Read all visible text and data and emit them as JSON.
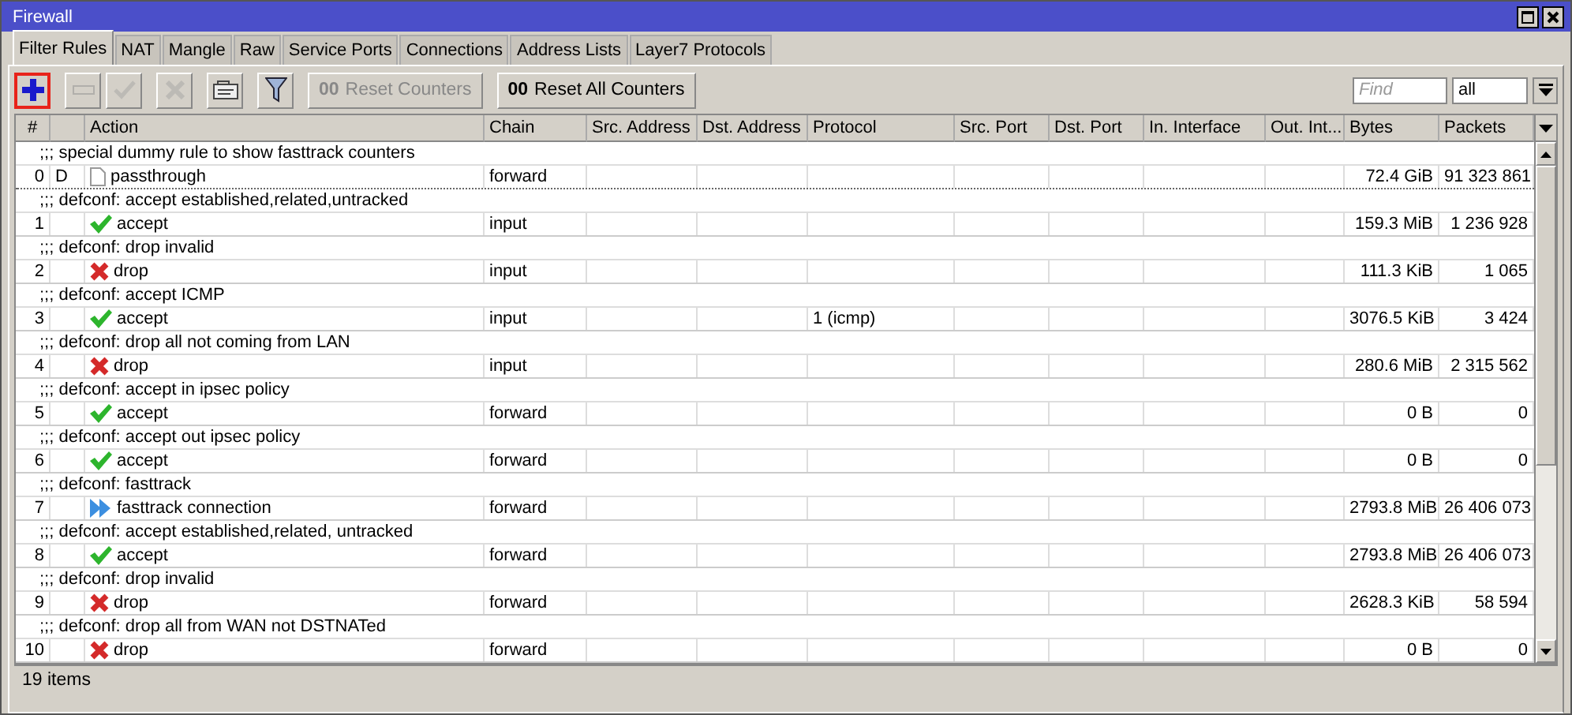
{
  "window": {
    "title": "Firewall"
  },
  "tabs": [
    {
      "label": "Filter Rules",
      "selected": true
    },
    {
      "label": "NAT",
      "selected": false
    },
    {
      "label": "Mangle",
      "selected": false
    },
    {
      "label": "Raw",
      "selected": false
    },
    {
      "label": "Service Ports",
      "selected": false
    },
    {
      "label": "Connections",
      "selected": false
    },
    {
      "label": "Address Lists",
      "selected": false
    },
    {
      "label": "Layer7 Protocols",
      "selected": false
    }
  ],
  "toolbar": {
    "buttons": [
      {
        "kind": "add",
        "disabled": false,
        "highlighted": true
      },
      {
        "kind": "remove",
        "disabled": true,
        "highlighted": false
      },
      {
        "kind": "enable",
        "disabled": true,
        "highlighted": false
      },
      {
        "kind": "disable",
        "disabled": true,
        "highlighted": false
      },
      {
        "kind": "comment",
        "disabled": false,
        "highlighted": false
      },
      {
        "kind": "filter",
        "disabled": false,
        "highlighted": false
      },
      {
        "kind": "counter",
        "label": "Reset Counters",
        "prefix": "00",
        "disabled": true,
        "highlighted": false
      },
      {
        "kind": "counter",
        "label": "Reset All Counters",
        "prefix": "00",
        "disabled": false,
        "highlighted": false
      }
    ],
    "find": {
      "placeholder": "Find"
    },
    "filter_select": {
      "value": "all"
    }
  },
  "table": {
    "columns": [
      "#",
      "Action",
      "Chain",
      "Src. Address",
      "Dst. Address",
      "Protocol",
      "Src. Port",
      "Dst. Port",
      "In. Interface",
      "Out. Int...",
      "Bytes",
      "Packets"
    ],
    "rows": [
      {
        "comment": ";;; special dummy rule to show fasttrack counters",
        "number": "0",
        "flag": "D",
        "action": "passthrough",
        "kind": "passthrough",
        "chain": "forward",
        "bytes": "72.4 GiB",
        "packets": "91 323 861"
      },
      {
        "comment": ";;; defconf: accept established,related,untracked",
        "number": "1",
        "action": "accept",
        "kind": "accept",
        "chain": "input",
        "bytes": "159.3 MiB",
        "packets": "1 236 928"
      },
      {
        "comment": ";;; defconf: drop invalid",
        "number": "2",
        "action": "drop",
        "kind": "drop",
        "chain": "input",
        "bytes": "111.3 KiB",
        "packets": "1 065"
      },
      {
        "comment": ";;; defconf: accept ICMP",
        "number": "3",
        "action": "accept",
        "kind": "accept",
        "chain": "input",
        "protocol": "1 (icmp)",
        "bytes": "3076.5 KiB",
        "packets": "3 424"
      },
      {
        "comment": ";;; defconf: drop all not coming from LAN",
        "number": "4",
        "action": "drop",
        "kind": "drop",
        "chain": "input",
        "bytes": "280.6 MiB",
        "packets": "2 315 562"
      },
      {
        "comment": ";;; defconf: accept in ipsec policy",
        "number": "5",
        "action": "accept",
        "kind": "accept",
        "chain": "forward",
        "bytes": "0 B",
        "packets": "0"
      },
      {
        "comment": ";;; defconf: accept out ipsec policy",
        "number": "6",
        "action": "accept",
        "kind": "accept",
        "chain": "forward",
        "bytes": "0 B",
        "packets": "0"
      },
      {
        "comment": ";;; defconf: fasttrack",
        "number": "7",
        "action": "fasttrack connection",
        "kind": "fasttrack",
        "chain": "forward",
        "bytes": "2793.8 MiB",
        "packets": "26 406 073"
      },
      {
        "comment": ";;; defconf: accept established,related, untracked",
        "number": "8",
        "action": "accept",
        "kind": "accept",
        "chain": "forward",
        "bytes": "2793.8 MiB",
        "packets": "26 406 073"
      },
      {
        "comment": ";;; defconf: drop invalid",
        "number": "9",
        "action": "drop",
        "kind": "drop",
        "chain": "forward",
        "bytes": "2628.3 KiB",
        "packets": "58 594"
      },
      {
        "comment": ";;; defconf:  drop all from WAN not DSTNATed",
        "number": "10",
        "action": "drop",
        "kind": "drop",
        "chain": "forward",
        "bytes": "0 B",
        "packets": "0"
      }
    ]
  },
  "status_bar": {
    "text": "19 items"
  }
}
